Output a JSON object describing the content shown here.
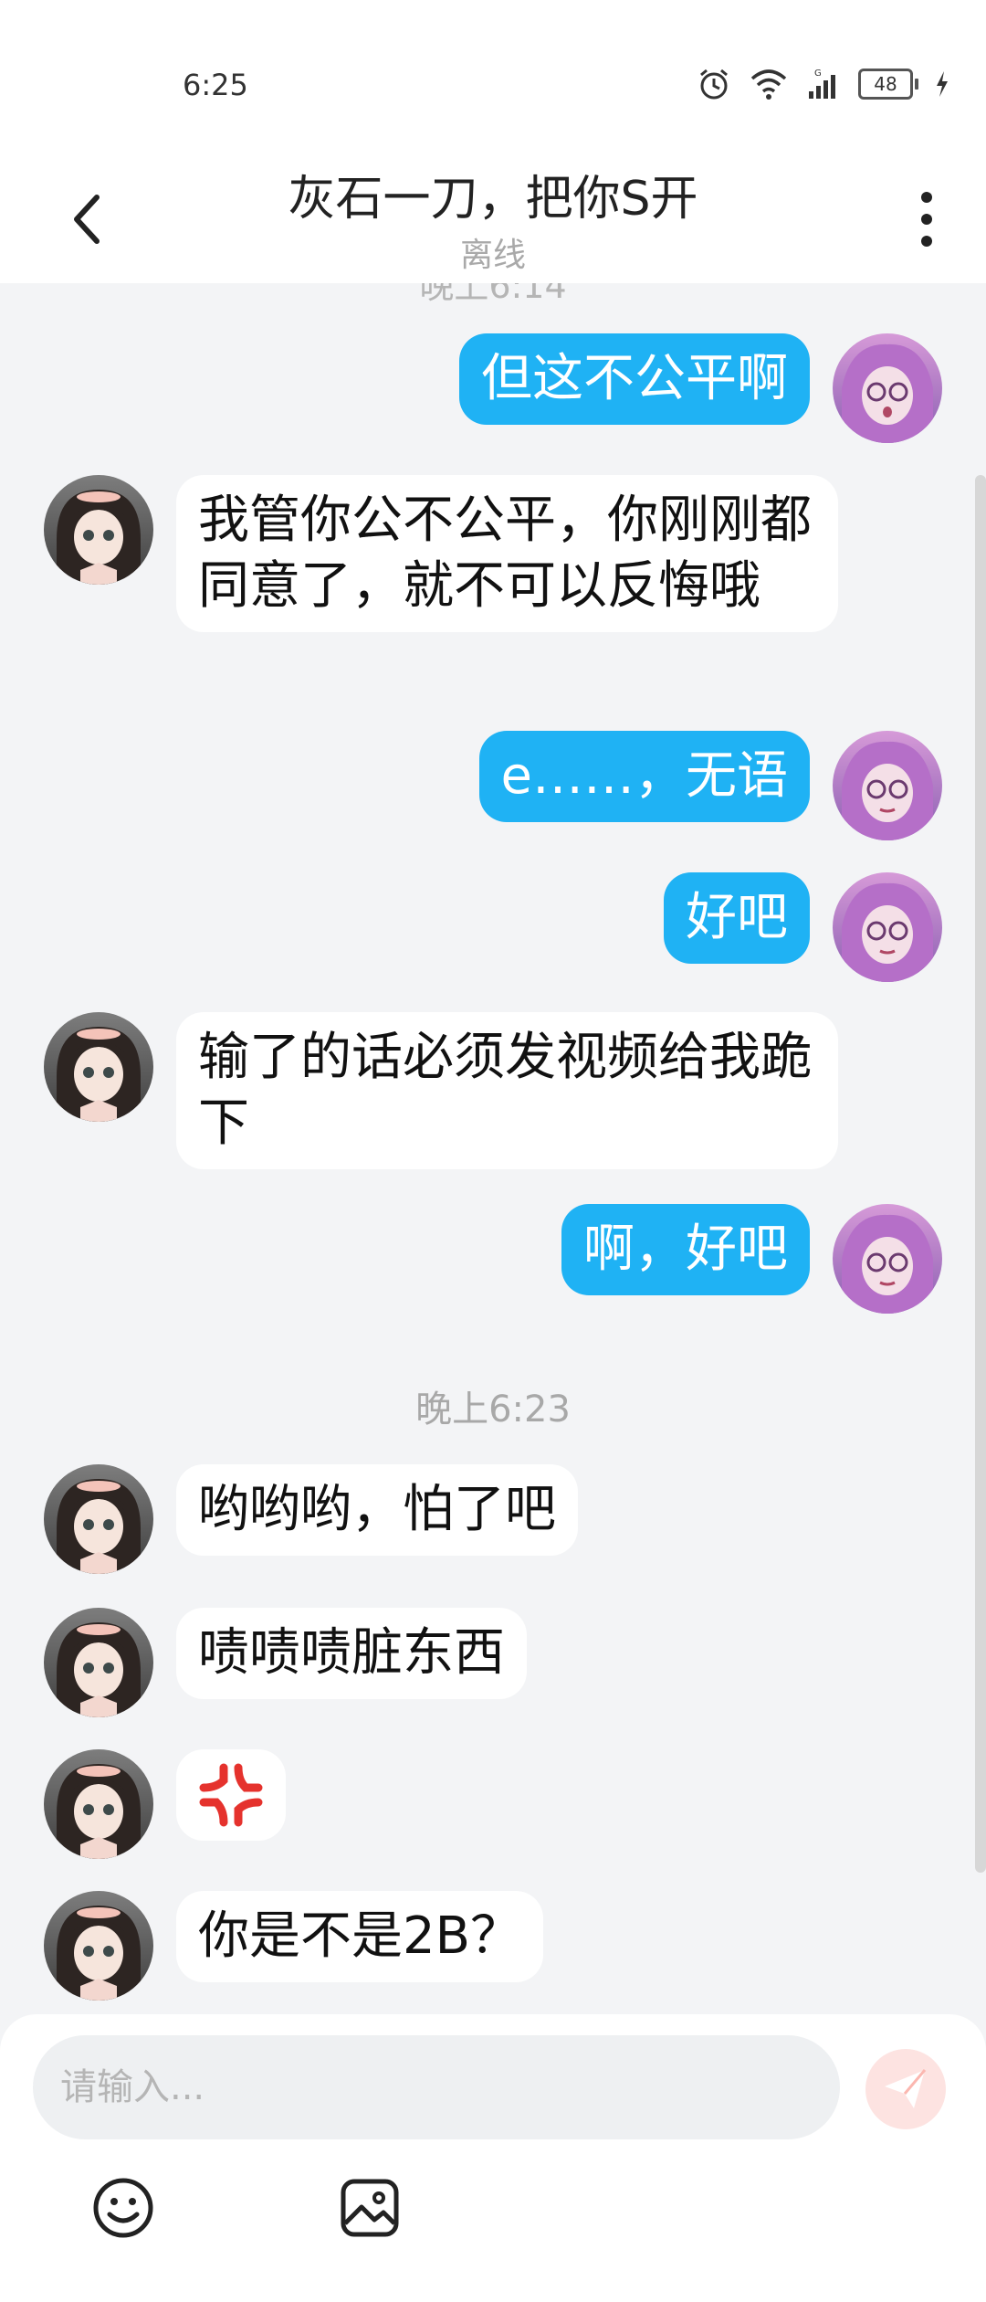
{
  "status_bar": {
    "time": "6:25",
    "battery": "48"
  },
  "header": {
    "title": "灰石一刀，把你S开",
    "subtitle": "离线",
    "back_icon": "chevron-left-icon",
    "more_icon": "more-vertical-icon"
  },
  "chat": {
    "cut_time": "晚上6:14",
    "timestamp": "晚上6:23",
    "messages": [
      {
        "from": "me",
        "text": "但这不公平啊"
      },
      {
        "from": "them",
        "text": "我管你公不公平，你刚刚都同意了，就不可以反悔哦"
      },
      {
        "from": "me",
        "text": "e……，无语"
      },
      {
        "from": "me",
        "text": "好吧"
      },
      {
        "from": "them",
        "text": "输了的话必须发视频给我跪下"
      },
      {
        "from": "me",
        "text": "啊，好吧"
      },
      {
        "from": "them",
        "text": "哟哟哟，怕了吧"
      },
      {
        "from": "them",
        "text": "啧啧啧脏东西"
      },
      {
        "from": "them",
        "text": "💢"
      },
      {
        "from": "them",
        "text": "你是不是2B？"
      }
    ]
  },
  "composer": {
    "placeholder": "请输入...",
    "send_icon": "send-icon",
    "emoji_icon": "emoji-icon",
    "image_icon": "image-icon"
  },
  "colors": {
    "outgoing_bubble": "#1fb2f4",
    "incoming_bubble": "#ffffff",
    "background": "#f3f4f6",
    "send_button": "#fde3e1"
  }
}
